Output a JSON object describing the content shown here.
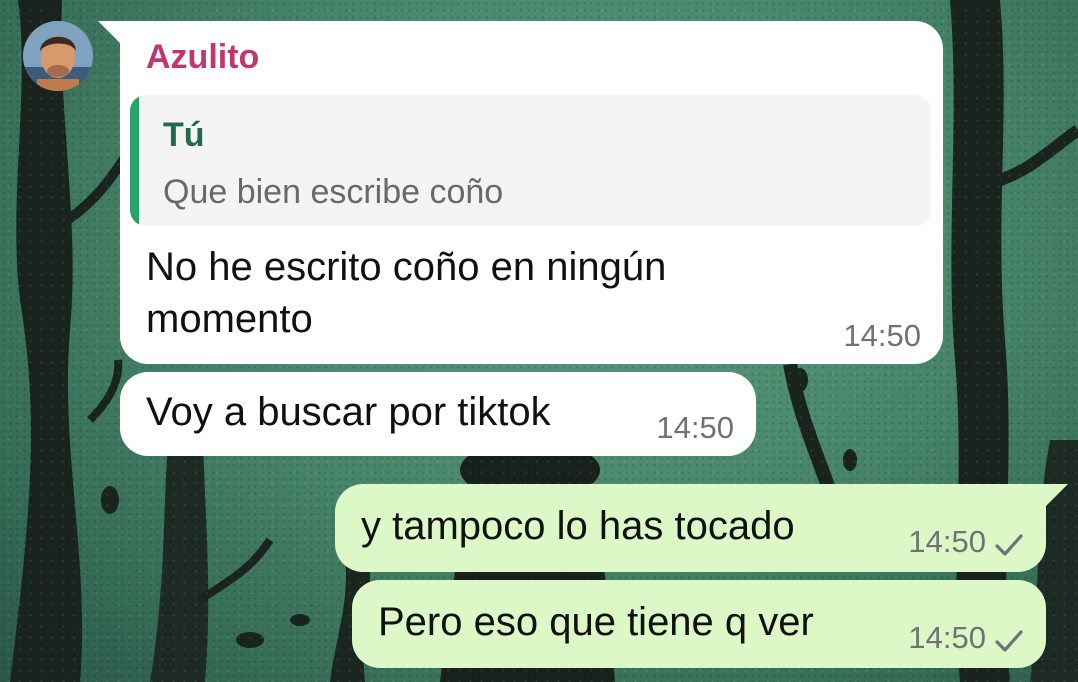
{
  "chat": {
    "messages": [
      {
        "direction": "incoming",
        "sender": "Azulito",
        "quote": {
          "author": "Tú",
          "text": "Que bien escribe coño"
        },
        "text": "No he escrito coño en ningún momento",
        "time": "14:50"
      },
      {
        "direction": "incoming",
        "text": "Voy a buscar por tiktok",
        "time": "14:50"
      },
      {
        "direction": "outgoing",
        "text": "y tampoco lo has tocado",
        "time": "14:50",
        "status": "sent"
      },
      {
        "direction": "outgoing",
        "text": "Pero eso que tiene q ver",
        "time": "14:50",
        "status": "sent"
      }
    ]
  },
  "icons": {
    "avatar": "contact-avatar",
    "status": "single-check-icon"
  },
  "colors": {
    "incoming_bubble": "#ffffff",
    "outgoing_bubble": "#dbf8c6",
    "sender_name": "#c2366f",
    "quote_bar": "#25a36b",
    "quote_author": "#1f6b4a",
    "timestamp": "#6e7476",
    "wallpaper": "#4b8a6e"
  }
}
